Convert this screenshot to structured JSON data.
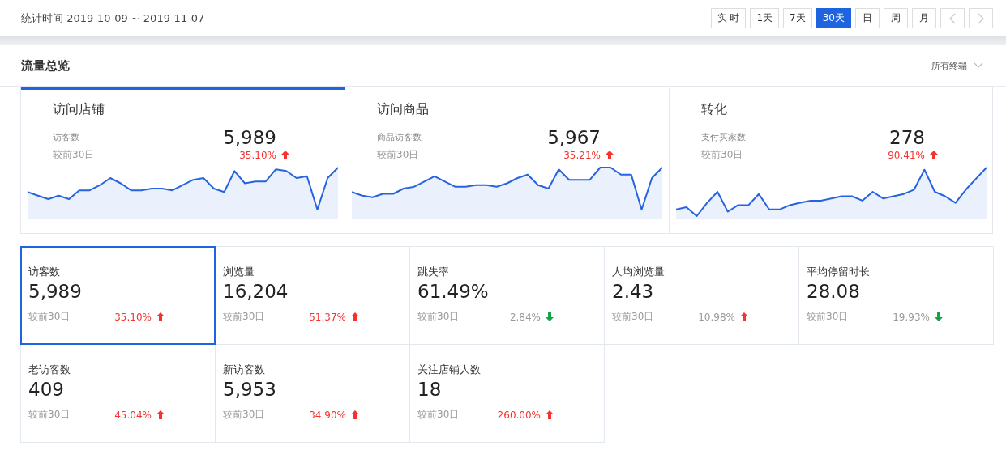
{
  "header": {
    "period": "统计时间 2019-10-09 ~ 2019-11-07",
    "ranges": [
      {
        "label": "实 时",
        "selected": false
      },
      {
        "label": "1天",
        "selected": false
      },
      {
        "label": "7天",
        "selected": false
      },
      {
        "label": "30天",
        "selected": true
      },
      {
        "label": "日",
        "selected": false
      },
      {
        "label": "周",
        "selected": false
      },
      {
        "label": "月",
        "selected": false
      }
    ]
  },
  "section": {
    "title": "流量总览",
    "filter": "所有终端"
  },
  "overview_cards": [
    {
      "title": "访问店铺",
      "metric": "访客数",
      "value": "5,989",
      "compare": "较前30日",
      "change": "35.10%",
      "rising": true,
      "selected": true
    },
    {
      "title": "访问商品",
      "metric": "商品访客数",
      "value": "5,967",
      "compare": "较前30日",
      "change": "35.21%",
      "rising": true,
      "selected": false
    },
    {
      "title": "转化",
      "metric": "支付买家数",
      "value": "278",
      "compare": "较前30日",
      "change": "90.41%",
      "rising": true,
      "selected": false
    }
  ],
  "metrics": [
    {
      "label": "访客数",
      "value": "5,989",
      "compare": "较前30日",
      "change": "35.10%",
      "rising": true,
      "highlight": true,
      "selected": true
    },
    {
      "label": "浏览量",
      "value": "16,204",
      "compare": "较前30日",
      "change": "51.37%",
      "rising": true,
      "highlight": true,
      "selected": false
    },
    {
      "label": "跳失率",
      "value": "61.49%",
      "compare": "较前30日",
      "change": "2.84%",
      "rising": false,
      "highlight": false,
      "selected": false
    },
    {
      "label": "人均浏览量",
      "value": "2.43",
      "compare": "较前30日",
      "change": "10.98%",
      "rising": true,
      "highlight": false,
      "selected": false
    },
    {
      "label": "平均停留时长",
      "value": "28.08",
      "compare": "较前30日",
      "change": "19.93%",
      "rising": false,
      "highlight": false,
      "selected": false
    },
    {
      "label": "老访客数",
      "value": "409",
      "compare": "较前30日",
      "change": "45.04%",
      "rising": true,
      "highlight": true,
      "selected": false
    },
    {
      "label": "新访客数",
      "value": "5,953",
      "compare": "较前30日",
      "change": "34.90%",
      "rising": true,
      "highlight": true,
      "selected": false
    },
    {
      "label": "关注店铺人数",
      "value": "18",
      "compare": "较前30日",
      "change": "260.00%",
      "rising": true,
      "highlight": true,
      "selected": false
    }
  ]
}
